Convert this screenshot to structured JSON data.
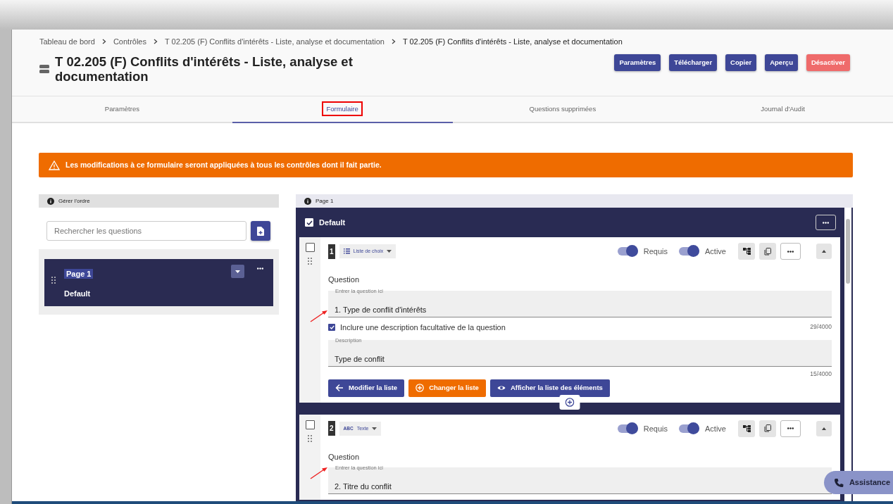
{
  "breadcrumb": [
    "Tableau de bord",
    "Contrôles",
    "T 02.205 (F) Conflits d'intérêts - Liste, analyse et documentation",
    "T 02.205 (F) Conflits d'intérêts - Liste, analyse et documentation"
  ],
  "title": "T 02.205 (F) Conflits d'intérêts - Liste, analyse et documentation",
  "actions": [
    {
      "label": "Paramètres",
      "kind": "primary"
    },
    {
      "label": "Télécharger",
      "kind": "primary"
    },
    {
      "label": "Copier",
      "kind": "primary"
    },
    {
      "label": "Aperçu",
      "kind": "primary"
    },
    {
      "label": "Désactiver",
      "kind": "danger"
    }
  ],
  "tabs": [
    {
      "label": "Paramètres",
      "selected": false,
      "highlighted": false
    },
    {
      "label": "Formulaire",
      "selected": true,
      "highlighted": true
    },
    {
      "label": "Questions supprimées",
      "selected": false,
      "highlighted": false
    },
    {
      "label": "Journal d'Audit",
      "selected": false,
      "highlighted": false
    }
  ],
  "alert": {
    "text": "Les modifications à ce formulaire seront appliquées à tous les contrôles dont il fait partie."
  },
  "order_panel": {
    "header": "Gérer l'ordre",
    "search": {
      "placeholder": "Rechercher les questions"
    },
    "pages": [
      {
        "title": "Page 1",
        "section": "Default"
      }
    ]
  },
  "form_panel": {
    "header": "Page 1",
    "section": {
      "title": "Default",
      "checked": true
    },
    "questions": [
      {
        "number": "1",
        "kind": "choice",
        "type": "Liste de choix",
        "checked": false,
        "required": true,
        "required_label": "Requis",
        "active": true,
        "active_label": "Active",
        "label": "Question",
        "field_label": "Entrer la question ici",
        "value": "1. Type de conflit d'intérêts",
        "annotated": true,
        "include_description": {
          "label": "Inclure une description facultative de la question",
          "checked": true
        },
        "count": "29/4000",
        "description": {
          "label": "Description",
          "value": "Type de conflit",
          "count": "15/4000"
        },
        "buttons": [
          {
            "label": "Modifier la liste",
            "kind": "back",
            "color": "#3e4797"
          },
          {
            "label": "Changer la liste",
            "kind": "change",
            "color": "#ef6c00"
          },
          {
            "label": "Afficher la liste des éléments",
            "kind": "view",
            "color": "#3e4797"
          }
        ]
      },
      {
        "number": "2",
        "kind": "text",
        "type": "Texte",
        "type_badge": "ABC",
        "checked": false,
        "required": true,
        "required_label": "Requis",
        "active": true,
        "active_label": "Active",
        "label": "Question",
        "field_label": "Entrer la question ici",
        "value": "2. Titre du conflit",
        "annotated": true
      }
    ]
  },
  "assistance": "Assistance"
}
